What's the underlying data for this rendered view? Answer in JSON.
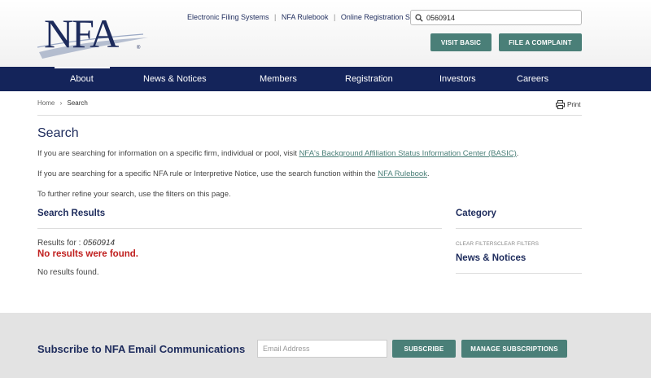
{
  "header": {
    "logo_text": "NFA",
    "links": [
      "Electronic Filing Systems",
      "NFA Rulebook",
      "Online Registration System"
    ],
    "link_separator": "|",
    "search_value": "0560914",
    "visit_basic_label": "VISIT BASIC",
    "file_complaint_label": "FILE A COMPLAINT"
  },
  "nav": {
    "items": [
      "About",
      "News & Notices",
      "Members",
      "Registration",
      "Investors",
      "Careers"
    ],
    "active": "About"
  },
  "breadcrumb": {
    "home": "Home",
    "separator": "›",
    "current": "Search"
  },
  "print_label": "Print",
  "page": {
    "title": "Search",
    "para1_prefix": "If you are searching for information on a specific firm, individual or pool, visit ",
    "para1_link": "NFA's Background Affiliation Status Information Center (BASIC)",
    "para1_suffix": ".",
    "para2_prefix": "If you are searching for a specific NFA rule or Interpretive Notice, use the search function within the ",
    "para2_link": "NFA Rulebook",
    "para2_suffix": ".",
    "para3": "To further refine your search, use the filters on this page."
  },
  "results": {
    "heading": "Search Results",
    "results_for_label": "Results for : ",
    "query": "0560914",
    "no_results_bold": "No results were found.",
    "no_results_text": "No results found."
  },
  "sidebar": {
    "heading": "Category",
    "clear_filters": "CLEAR FILTERSCLEAR FILTERS",
    "category": "News & Notices"
  },
  "footer": {
    "title": "Subscribe to NFA Email Communications",
    "email_placeholder": "Email Address",
    "subscribe_label": "SUBSCRIBE",
    "manage_label": "MANAGE SUBSCRIPTIONS"
  },
  "colors": {
    "navy": "#14245a",
    "teal": "#4a7f78",
    "error_red": "#c0201f"
  }
}
